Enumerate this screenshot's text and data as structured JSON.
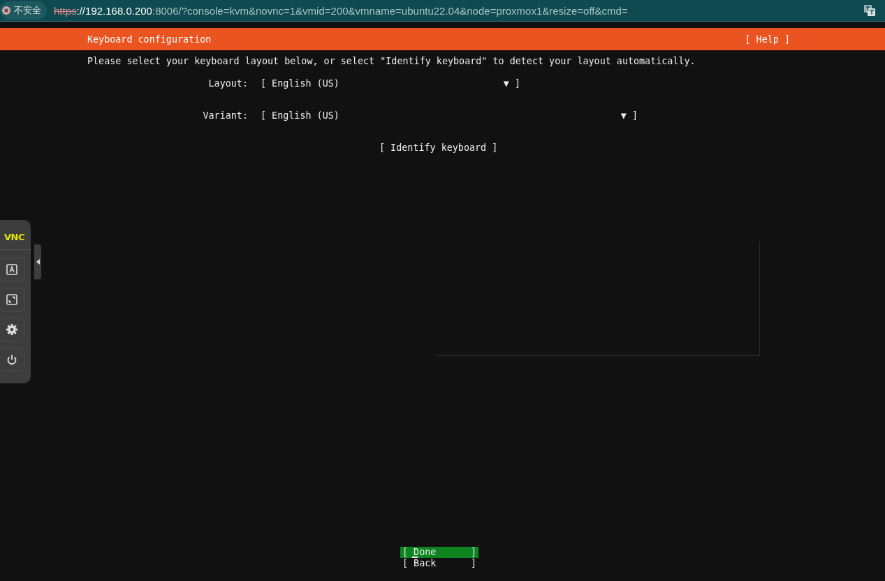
{
  "browser": {
    "security_label": "不安全",
    "url": [
      {
        "kind": "scheme",
        "text": "https"
      },
      {
        "kind": "host",
        "text": "://192.168.0.200"
      },
      {
        "kind": "path",
        "text": ":8006/?console=kvm&novnc=1&vmid=200&vmname=ubuntu22.04&node=proxmox1&resize=off&cmd="
      }
    ]
  },
  "novnc_panel": {
    "logo": "VNC",
    "buttons": [
      {
        "kind": "keyboard"
      },
      {
        "kind": "fullscreen"
      },
      {
        "kind": "settings"
      },
      {
        "kind": "power"
      }
    ]
  },
  "header": {
    "title": "Keyboard configuration",
    "help": "[ Help ]"
  },
  "instruction": "Please select your keyboard layout below, or select \"Identify keyboard\" to detect your layout automatically.",
  "fields": [
    {
      "label": "Layout:",
      "value": "[ English (US)",
      "end": "▼ ]",
      "kind": "narrow"
    },
    {
      "label": "Variant:",
      "value": "[ English (US)",
      "end": "▼ ]",
      "kind": "wide"
    }
  ],
  "identify_button": "[ Identify keyboard ]",
  "footer_buttons": [
    {
      "label": "[ Done",
      "end": "]",
      "selected": true
    },
    {
      "label": "[ Back",
      "end": "]",
      "selected": false
    }
  ]
}
